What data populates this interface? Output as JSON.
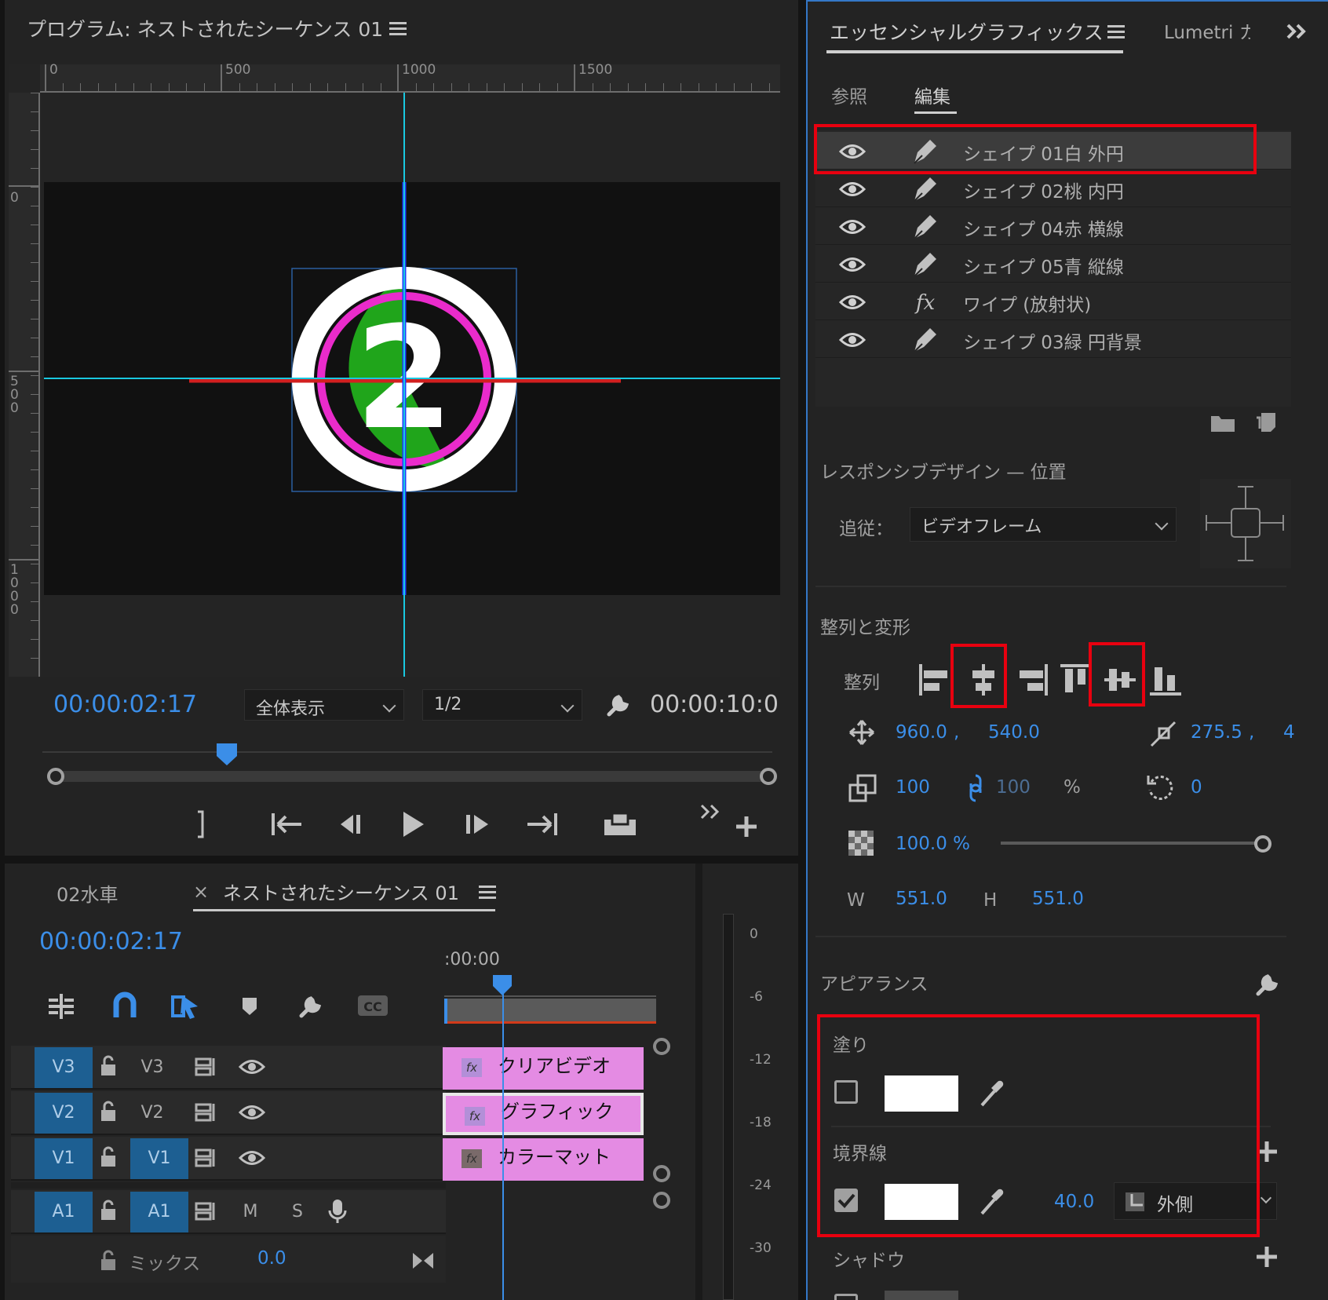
{
  "program": {
    "title": "プログラム: ネストされたシーケンス 01",
    "ruler_h": [
      "0",
      "500",
      "1000",
      "1500"
    ],
    "ruler_v": [
      "0",
      "500",
      "1000"
    ],
    "playhead_number": "2",
    "current_tc": "00:00:02:17",
    "zoom_select": "全体表示",
    "resolution_select": "1/2",
    "duration_tc": "00:00:10:0"
  },
  "timeline": {
    "tabs": [
      "02水車",
      "ネストされたシーケンス 01"
    ],
    "close_glyph": "×",
    "current_tc": "00:00:02:17",
    "ruler_start": ":00:00",
    "tracks": [
      {
        "target": "V3",
        "name": "V3",
        "target_on": false
      },
      {
        "target": "V2",
        "name": "V2",
        "target_on": false
      },
      {
        "target": "V1",
        "name": "V1",
        "target_on": true
      }
    ],
    "audio": {
      "target": "A1",
      "name": "A1",
      "m": "M",
      "s": "S"
    },
    "mix_label": "ミックス",
    "mix_value": "0.0",
    "clips": [
      "クリアビデオ",
      "グラフィック",
      "カラーマット"
    ],
    "fx_label": "fx"
  },
  "meter": {
    "ticks": [
      "0",
      "-6",
      "-12",
      "-18",
      "-24",
      "-30"
    ]
  },
  "eg": {
    "title": "エッセンシャルグラフィックス",
    "lumetri_tab": "Lumetri カ",
    "subtabs": [
      "参照",
      "編集"
    ],
    "layers": [
      {
        "name": "シェイプ 01白 外円",
        "icon": "pen-icon"
      },
      {
        "name": "シェイプ 02桃 内円",
        "icon": "pen-icon"
      },
      {
        "name": "シェイプ 04赤 横線",
        "icon": "pen-icon"
      },
      {
        "name": "シェイプ 05青 縦線",
        "icon": "pen-icon"
      },
      {
        "name": "ワイプ (放射状)",
        "icon": "fx-icon"
      },
      {
        "name": "シェイプ 03緑 円背景",
        "icon": "pen-icon"
      }
    ],
    "responsive_title": "レスポンシブデザイン — 位置",
    "follow_label": "追従：",
    "follow_value": "ビデオフレーム",
    "align_title": "整列と変形",
    "align_label": "整列",
    "pos_x": "960.0",
    "pos_y": "540.0",
    "anchor_x": "275.5",
    "anchor_y": "4",
    "scale": "100",
    "scale_linked": "100",
    "percent": "%",
    "rotation": "0",
    "opacity": "100.0 %",
    "opacity_level": 1.0,
    "w_label": "W",
    "w_value": "551.0",
    "h_label": "H",
    "h_value": "551.0",
    "appearance_title": "アピアランス",
    "fill_label": "塗り",
    "stroke_label": "境界線",
    "stroke_width": "40.0",
    "stroke_type": "外側",
    "shadow_label": "シャドウ"
  },
  "colors": {
    "accent": "#3b8ee8",
    "highlight": "#e8000f",
    "clip": "#e48be3",
    "target": "#1d5f92"
  }
}
